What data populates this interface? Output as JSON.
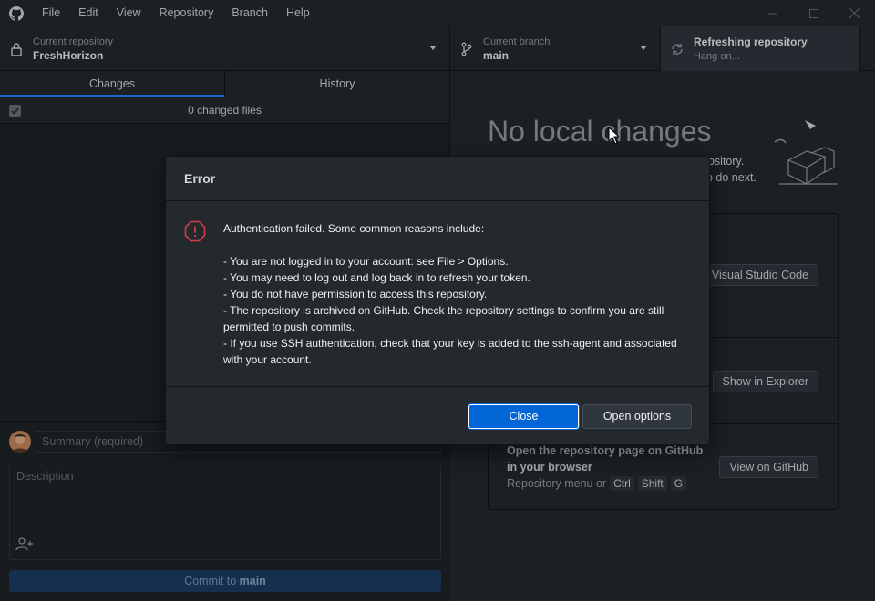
{
  "menu": [
    "File",
    "Edit",
    "View",
    "Repository",
    "Branch",
    "Help"
  ],
  "toolbar": {
    "repo_label": "Current repository",
    "repo_value": "FreshHorizon",
    "branch_label": "Current branch",
    "branch_value": "main",
    "refresh_label": "Refreshing repository",
    "refresh_value": "Hang on..."
  },
  "tabs": [
    "Changes",
    "History"
  ],
  "changes": {
    "count_text": "0 changed files"
  },
  "commit": {
    "summary_placeholder": "Summary (required)",
    "description_placeholder": "Description",
    "button_prefix": "Commit to ",
    "button_branch": "main"
  },
  "main": {
    "title": "No local changes",
    "subtitle_1": "pository.",
    "subtitle_2": "o do next.",
    "action_1_button": "n Visual Studio Code",
    "action_2_button": "Show in Explorer",
    "action_3_title": "Open the repository page on GitHub in your browser",
    "action_3_sub": "Repository menu or",
    "action_3_keys": [
      "Ctrl",
      "Shift",
      "G"
    ],
    "action_3_button": "View on GitHub"
  },
  "dialog": {
    "title": "Error",
    "lines": [
      "Authentication failed. Some common reasons include:",
      "",
      "- You are not logged in to your account: see File > Options.",
      "- You may need to log out and log back in to refresh your token.",
      "- You do not have permission to access this repository.",
      "- The repository is archived on GitHub. Check the repository settings to confirm you are still permitted to push commits.",
      "- If you use SSH authentication, check that your key is added to the ssh-agent and associated with your account."
    ],
    "close_label": "Close",
    "options_label": "Open options"
  },
  "colors": {
    "accent": "#0366d6",
    "error": "#d73a49",
    "tab_indicator": "#2188ff"
  }
}
